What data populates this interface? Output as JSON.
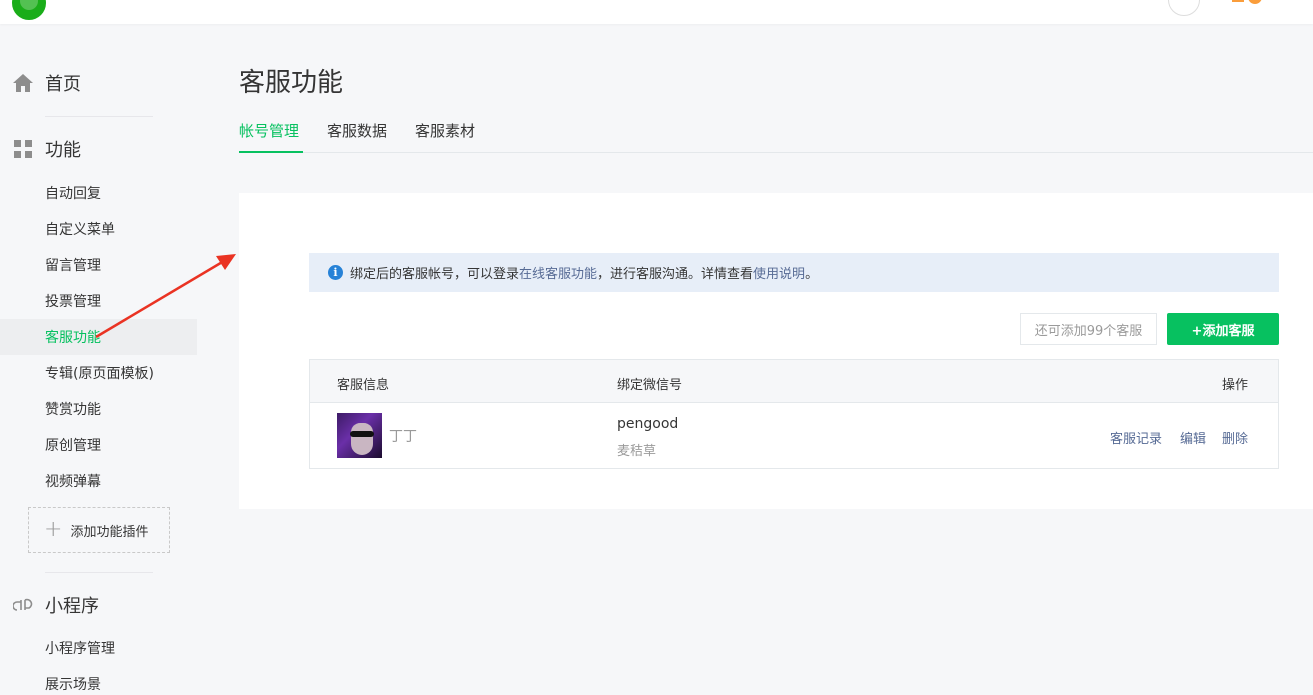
{
  "colors": {
    "accent": "#07c160",
    "link": "#576b95",
    "arrow": "#ea3323"
  },
  "sidebar": {
    "home": {
      "icon": "home-icon",
      "label": "首页"
    },
    "features": {
      "icon": "grid-icon",
      "label": "功能"
    },
    "feature_items": [
      {
        "label": "自动回复",
        "active": false
      },
      {
        "label": "自定义菜单",
        "active": false
      },
      {
        "label": "留言管理",
        "active": false
      },
      {
        "label": "投票管理",
        "active": false
      },
      {
        "label": "客服功能",
        "active": true
      },
      {
        "label": "专辑(原页面模板)",
        "active": false
      },
      {
        "label": "赞赏功能",
        "active": false
      },
      {
        "label": "原创管理",
        "active": false
      },
      {
        "label": "视频弹幕",
        "active": false
      }
    ],
    "add_plugin": "添加功能插件",
    "miniprogram": {
      "icon": "link-icon",
      "label": "小程序"
    },
    "miniprogram_items": [
      {
        "label": "小程序管理"
      },
      {
        "label": "展示场景"
      }
    ]
  },
  "main": {
    "title": "客服功能",
    "tabs": [
      {
        "label": "帐号管理",
        "active": true
      },
      {
        "label": "客服数据",
        "active": false
      },
      {
        "label": "客服素材",
        "active": false
      }
    ],
    "notice": {
      "prefix": "绑定后的客服帐号，可以登录",
      "link1": "在线客服功能",
      "middle": "，进行客服沟通。详情查看",
      "link2": "使用说明",
      "suffix": "。"
    },
    "quota_text": "还可添加99个客服",
    "add_button": "+添加客服",
    "table": {
      "headers": {
        "info": "客服信息",
        "wechat": "绑定微信号",
        "ops": "操作"
      },
      "rows": [
        {
          "name": "丁丁",
          "wechat_id": "pengood",
          "wechat_nick": "麦秸草",
          "ops": {
            "record": "客服记录",
            "edit": "编辑",
            "delete": "删除"
          }
        }
      ]
    }
  }
}
